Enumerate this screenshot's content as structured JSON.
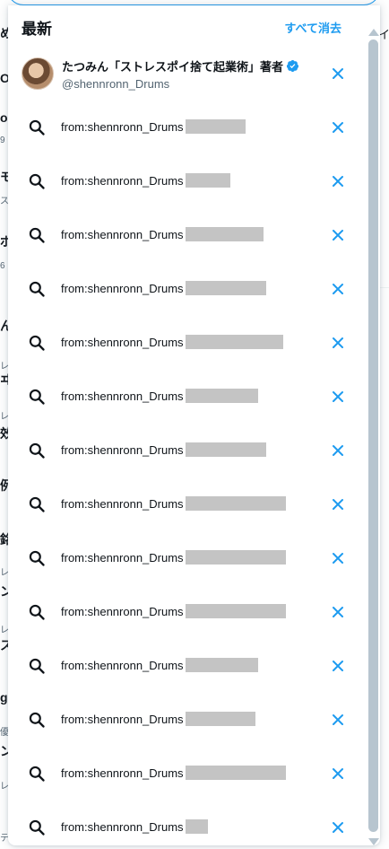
{
  "dropdown": {
    "title": "最新",
    "clear_all_label": "すべて消去",
    "user_entry": {
      "name": "たつみん「ストレスポイ捨て起業術」著者",
      "handle": "@shennronn_Drums"
    },
    "queries": [
      {
        "text": "from:shennronn_Drums",
        "redacted_fraction": 0.6
      },
      {
        "text": "from:shennronn_Drums",
        "redacted_fraction": 0.45
      },
      {
        "text": "from:shennronn_Drums",
        "redacted_fraction": 0.78
      },
      {
        "text": "from:shennronn_Drums",
        "redacted_fraction": 0.8
      },
      {
        "text": "from:shennronn_Drums",
        "redacted_fraction": 0.97
      },
      {
        "text": "from:shennronn_Drums",
        "redacted_fraction": 0.72
      },
      {
        "text": "from:shennronn_Drums",
        "redacted_fraction": 0.8
      },
      {
        "text": "from:shennronn_Drums",
        "redacted_fraction": 1.0
      },
      {
        "text": "from:shennronn_Drums",
        "redacted_fraction": 1.0
      },
      {
        "text": "from:shennronn_Drums",
        "redacted_fraction": 1.0
      },
      {
        "text": "from:shennronn_Drums",
        "redacted_fraction": 0.72
      },
      {
        "text": "from:shennronn_Drums",
        "redacted_fraction": 0.7
      },
      {
        "text": "from:shennronn_Drums",
        "redacted_fraction": 1.0
      },
      {
        "text": "from:shennronn_Drums",
        "redacted_fraction": 0.22
      }
    ]
  },
  "colors": {
    "accent": "#1d9bf0",
    "text_primary": "#0f1419",
    "text_secondary": "#536471",
    "redaction": "#c4c4c4",
    "scrollbar": "#b7c5cf"
  },
  "icons": {
    "query": "search-icon",
    "remove": "close-icon",
    "verified": "verified-badge-icon"
  }
}
